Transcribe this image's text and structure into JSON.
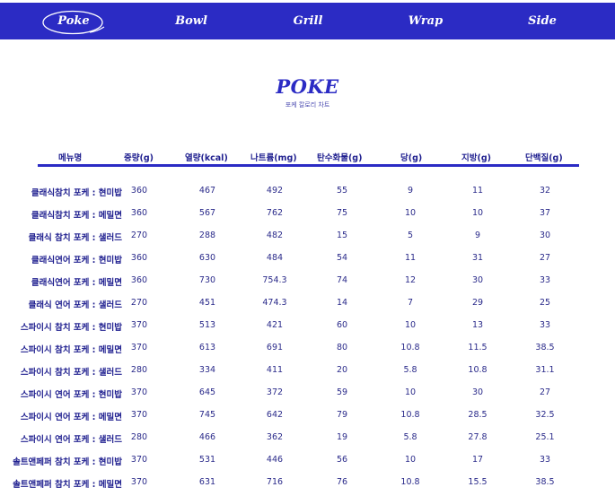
{
  "nav": {
    "items": [
      {
        "label": "Poke",
        "active": true
      },
      {
        "label": "Bowl",
        "active": false
      },
      {
        "label": "Grill",
        "active": false
      },
      {
        "label": "Wrap",
        "active": false
      },
      {
        "label": "Side",
        "active": false
      }
    ]
  },
  "header": {
    "title": "POKE",
    "subtitle": "포케 칼로리 차트"
  },
  "table": {
    "columns": [
      "메뉴명",
      "중량(g)",
      "열량(kcal)",
      "나트륨(mg)",
      "탄수화물(g)",
      "당(g)",
      "지방(g)",
      "단백질(g)"
    ],
    "rows": [
      [
        "클래식참치 포케 : 현미밥",
        "360",
        "467",
        "492",
        "55",
        "9",
        "11",
        "32"
      ],
      [
        "클래식참치 포케 : 메밀면",
        "360",
        "567",
        "762",
        "75",
        "10",
        "10",
        "37"
      ],
      [
        "클래식 참치 포케 : 샐러드",
        "270",
        "288",
        "482",
        "15",
        "5",
        "9",
        "30"
      ],
      [
        "클래식연어 포케 : 현미밥",
        "360",
        "630",
        "484",
        "54",
        "11",
        "31",
        "27"
      ],
      [
        "클래식연어 포케 : 메밀면",
        "360",
        "730",
        "754.3",
        "74",
        "12",
        "30",
        "33"
      ],
      [
        "클래식 연어 포케 : 샐러드",
        "270",
        "451",
        "474.3",
        "14",
        "7",
        "29",
        "25"
      ],
      [
        "스파이시 참치 포케 : 현미밥",
        "370",
        "513",
        "421",
        "60",
        "10",
        "13",
        "33"
      ],
      [
        "스파이시 참치 포케 : 메밀면",
        "370",
        "613",
        "691",
        "80",
        "10.8",
        "11.5",
        "38.5"
      ],
      [
        "스파이시 참치 포케 : 샐러드",
        "280",
        "334",
        "411",
        "20",
        "5.8",
        "10.8",
        "31.1"
      ],
      [
        "스파이시 연어 포케 : 현미밥",
        "370",
        "645",
        "372",
        "59",
        "10",
        "30",
        "27"
      ],
      [
        "스파이시 연어 포케 : 메밀면",
        "370",
        "745",
        "642",
        "79",
        "10.8",
        "28.5",
        "32.5"
      ],
      [
        "스파이시 연어 포케 : 샐러드",
        "280",
        "466",
        "362",
        "19",
        "5.8",
        "27.8",
        "25.1"
      ],
      [
        "솔트앤페퍼 참치 포케 : 현미밥",
        "370",
        "531",
        "446",
        "56",
        "10",
        "17",
        "33"
      ],
      [
        "솔트앤페퍼 참치 포케 : 메밀면",
        "370",
        "631",
        "716",
        "76",
        "10.8",
        "15.5",
        "38.5"
      ]
    ]
  },
  "colors": {
    "brand": "#2b2bc4",
    "text": "#1f1f8f"
  }
}
